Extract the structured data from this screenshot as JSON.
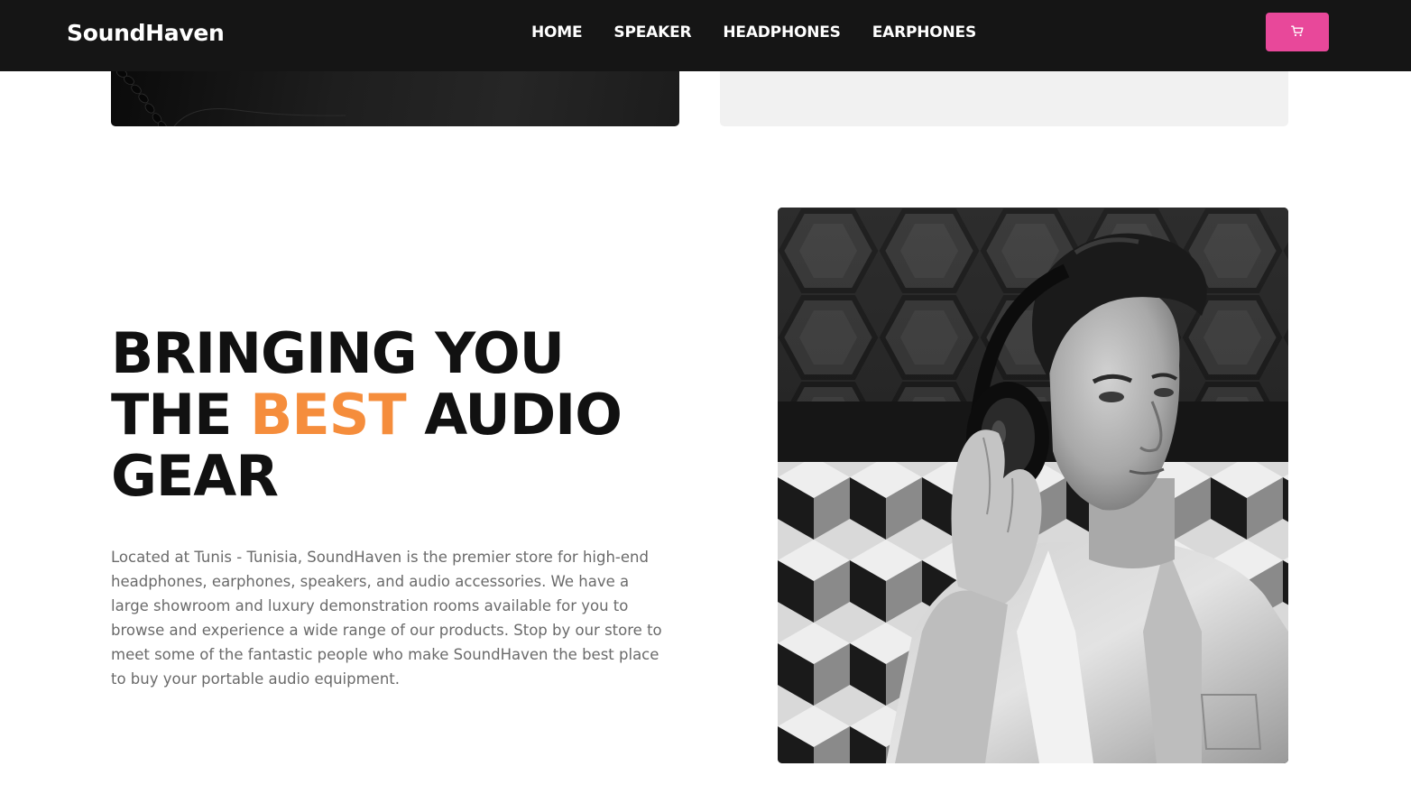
{
  "nav": {
    "brand": "SoundHaven",
    "links": [
      "HOME",
      "SPEAKER",
      "HEADPHONES",
      "EARPHONES"
    ],
    "cart_icon": "cart-icon",
    "cart_button_color": "#e8489a"
  },
  "about": {
    "headline_line1": "BRINGING YOU",
    "headline_line2_before": "THE ",
    "headline_accent": "BEST",
    "headline_line2_after": " AUDIO",
    "headline_line3": "GEAR",
    "accent_color": "#f58d3c",
    "description": "Located at Tunis - Tunisia, SoundHaven is the premier store for high-end headphones, earphones, speakers, and audio accessories. We have a large showroom and luxury demonstration rooms available for you to browse and experience a wide range of our products. Stop by our store to meet some of the fantastic people who make SoundHaven the best place to buy your portable audio equipment."
  },
  "colors": {
    "navbar_bg": "#151515",
    "page_bg": "#ffffff",
    "light_card_bg": "#f1f1f1"
  }
}
